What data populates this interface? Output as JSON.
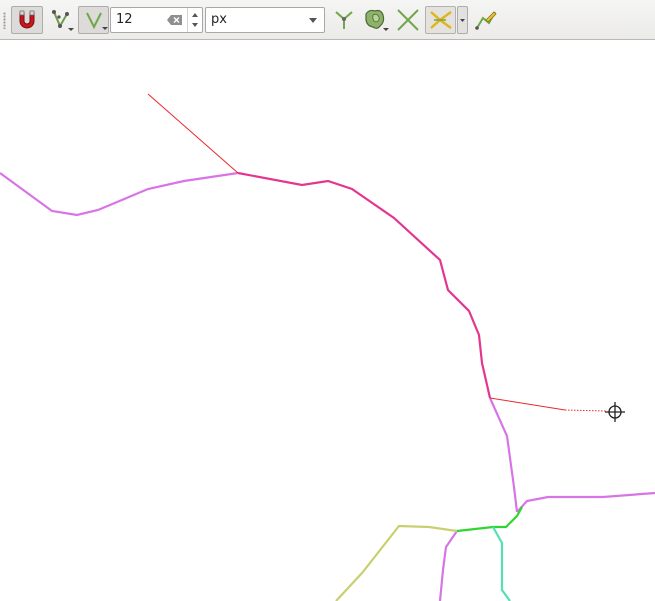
{
  "toolbar": {
    "buttons": [
      {
        "name": "snapping-toggle",
        "icon": "magnet-icon",
        "checked": true
      },
      {
        "name": "snapping-mode",
        "icon": "vertex-layers-icon",
        "checked": false
      },
      {
        "name": "snapping-type",
        "icon": "vertex-snap-icon",
        "checked": true
      },
      {
        "name": "topological-editing",
        "icon": "topology-icon",
        "checked": false
      },
      {
        "name": "avoid-overlap",
        "icon": "avoid-overlap-icon",
        "checked": false
      },
      {
        "name": "snap-on-intersection",
        "icon": "intersection-icon",
        "checked": false
      },
      {
        "name": "self-snapping",
        "icon": "self-snap-icon",
        "checked": true
      },
      {
        "name": "tracing",
        "icon": "trace-icon",
        "checked": false
      }
    ],
    "tolerance": {
      "value": "12"
    },
    "units": {
      "selected": "px"
    }
  },
  "colors": {
    "road_violet": "#d875e6",
    "road_magenta": "#e3368f",
    "road_olive": "#c9cf70",
    "road_green": "#2fd62f",
    "road_cyan": "#55e0b0",
    "snap_line": "#e8282b",
    "cursor": "#222222"
  }
}
